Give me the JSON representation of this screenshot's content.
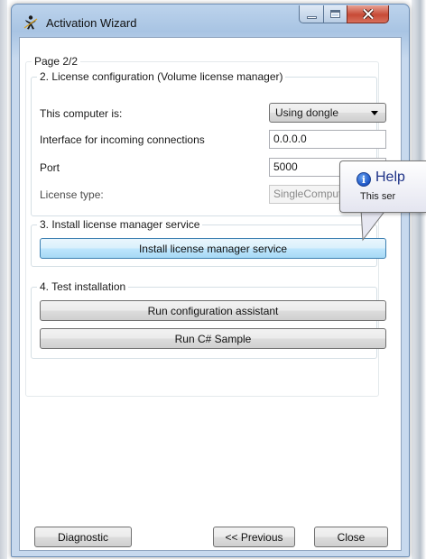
{
  "window": {
    "title": "Activation Wizard",
    "caption_buttons": {
      "minimize_icon": "minimize-icon",
      "maximize_icon": "maximize-icon",
      "close_icon": "close-icon",
      "close_color": "#c74a36"
    }
  },
  "wizard": {
    "page_label": "Page 2/2",
    "license_config": {
      "legend": "2. License configuration (Volume license manager)",
      "computer_label": "This computer is:",
      "computer_value": "Using dongle",
      "interface_label": "Interface for incoming connections",
      "interface_value": "0.0.0.0",
      "port_label": "Port",
      "port_value": "5000",
      "license_type_label": "License type:",
      "license_type_value": "SingleComputer"
    },
    "install_service": {
      "legend": "3. Install license manager service",
      "button_label": "Install license manager service"
    },
    "test_installation": {
      "legend": "4. Test installation",
      "config_button_label": "Run configuration assistant",
      "sample_button_label": "Run C# Sample"
    },
    "footer": {
      "diagnostic_label": "Diagnostic",
      "previous_label": "<< Previous",
      "close_label": "Close"
    }
  },
  "tooltip": {
    "icon": "info-icon",
    "title": "Help",
    "text": "This ser"
  }
}
